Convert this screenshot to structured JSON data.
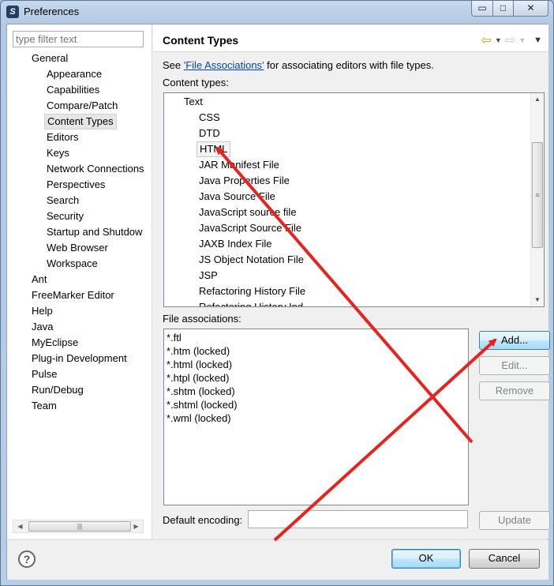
{
  "window": {
    "title": "Preferences",
    "controls": {
      "minimize": "▭",
      "maximize": "□",
      "close": "✕"
    }
  },
  "filter": {
    "placeholder": "type filter text"
  },
  "tree": [
    {
      "label": "General",
      "indent": 1
    },
    {
      "label": "Appearance",
      "indent": 2
    },
    {
      "label": "Capabilities",
      "indent": 2
    },
    {
      "label": "Compare/Patch",
      "indent": 2
    },
    {
      "label": "Content Types",
      "indent": 2,
      "selected": true
    },
    {
      "label": "Editors",
      "indent": 2
    },
    {
      "label": "Keys",
      "indent": 2
    },
    {
      "label": "Network Connections",
      "indent": 2
    },
    {
      "label": "Perspectives",
      "indent": 2
    },
    {
      "label": "Search",
      "indent": 2
    },
    {
      "label": "Security",
      "indent": 2
    },
    {
      "label": "Startup and Shutdow",
      "indent": 2
    },
    {
      "label": "Web Browser",
      "indent": 2
    },
    {
      "label": "Workspace",
      "indent": 2
    },
    {
      "label": "Ant",
      "indent": 1
    },
    {
      "label": "FreeMarker Editor",
      "indent": 1
    },
    {
      "label": "Help",
      "indent": 1
    },
    {
      "label": "Java",
      "indent": 1
    },
    {
      "label": "MyEclipse",
      "indent": 1
    },
    {
      "label": "Plug-in Development",
      "indent": 1
    },
    {
      "label": "Pulse",
      "indent": 1
    },
    {
      "label": "Run/Debug",
      "indent": 1
    },
    {
      "label": "Team",
      "indent": 1
    }
  ],
  "page": {
    "title": "Content Types",
    "see_prefix": "See ",
    "see_link": "'File Associations'",
    "see_suffix": " for associating editors with file types.",
    "content_types_label": "Content types:",
    "file_associations_label": "File associations:",
    "default_encoding_label": "Default encoding:",
    "default_encoding_value": ""
  },
  "content_types": [
    {
      "label": "Text",
      "indent": 1
    },
    {
      "label": "CSS",
      "indent": 2
    },
    {
      "label": "DTD",
      "indent": 2
    },
    {
      "label": "HTML",
      "indent": 2,
      "selected": true
    },
    {
      "label": "JAR Manifest File",
      "indent": 2
    },
    {
      "label": "Java Properties File",
      "indent": 2
    },
    {
      "label": "Java Source File",
      "indent": 2
    },
    {
      "label": "JavaScript source file",
      "indent": 2
    },
    {
      "label": "JavaScript Source File",
      "indent": 2
    },
    {
      "label": "JAXB Index File",
      "indent": 2
    },
    {
      "label": "JS Object Notation File",
      "indent": 2
    },
    {
      "label": "JSP",
      "indent": 2
    },
    {
      "label": "Refactoring History File",
      "indent": 2
    },
    {
      "label": "Refactoring History Ind",
      "indent": 2
    }
  ],
  "file_associations": [
    "*.ftl",
    "*.htm (locked)",
    "*.html (locked)",
    "*.htpl (locked)",
    "*.shtm (locked)",
    "*.shtml (locked)",
    "*.wml (locked)"
  ],
  "buttons": {
    "add": "Add...",
    "edit": "Edit...",
    "remove": "Remove",
    "update": "Update",
    "ok": "OK",
    "cancel": "Cancel"
  },
  "annotation_color": "#e8231d"
}
